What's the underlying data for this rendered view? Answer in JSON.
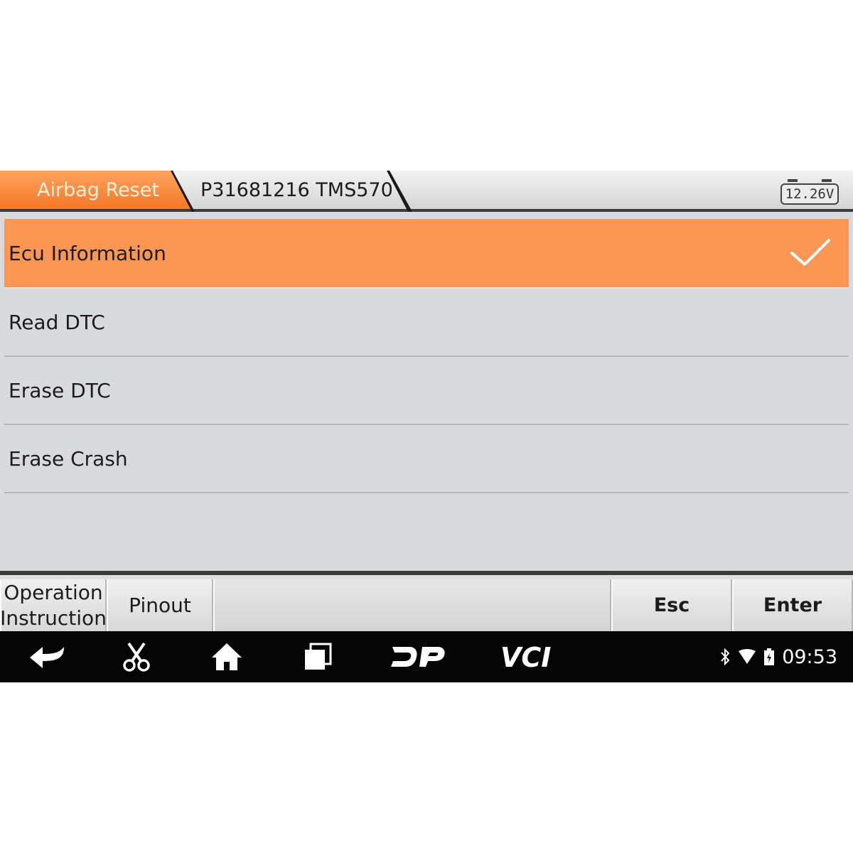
{
  "breadcrumb": {
    "items": [
      {
        "label": "Airbag Reset"
      },
      {
        "label": "P31681216 TMS570"
      }
    ]
  },
  "battery": {
    "voltage": "12.26V"
  },
  "menu": {
    "items": [
      {
        "label": "Ecu Information",
        "selected": true
      },
      {
        "label": "Read DTC",
        "selected": false
      },
      {
        "label": "Erase DTC",
        "selected": false
      },
      {
        "label": "Erase Crash",
        "selected": false
      }
    ]
  },
  "buttons": {
    "operation_line1": "Operation",
    "operation_line2": "Instruction",
    "pinout": "Pinout",
    "esc": "Esc",
    "enter": "Enter"
  },
  "navbar": {
    "icons": [
      "back-icon",
      "scissors-icon",
      "home-icon",
      "recent-apps-icon",
      "dp-icon",
      "vci-icon"
    ],
    "dp_label": "DP",
    "vci_label": "VCI"
  },
  "status": {
    "icons": [
      "bluetooth-icon",
      "wifi-icon",
      "battery-icon"
    ],
    "time": "09:53"
  },
  "colors": {
    "accent": "#fb9654",
    "nav_background": "#040404"
  }
}
